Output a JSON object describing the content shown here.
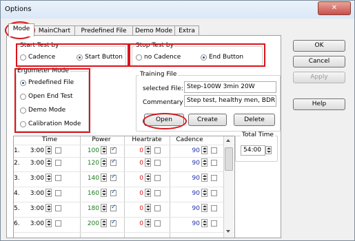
{
  "window": {
    "title": "Options",
    "close_glyph": "✕"
  },
  "tabs": [
    {
      "label": "Mode",
      "selected": true
    },
    {
      "label": "MainChart",
      "selected": false
    },
    {
      "label": "Predefined File",
      "selected": false
    },
    {
      "label": "Demo Mode",
      "selected": false
    },
    {
      "label": "Extra",
      "selected": false
    }
  ],
  "start_test": {
    "title": "Start Test by",
    "options": [
      {
        "label": "Cadence",
        "selected": false
      },
      {
        "label": "Start Button",
        "selected": true
      }
    ]
  },
  "stop_test": {
    "title": "Stop Test by",
    "options": [
      {
        "label": "no Cadence",
        "selected": false
      },
      {
        "label": "End Button",
        "selected": true
      }
    ]
  },
  "ergometer_mode": {
    "title": "Ergometer Mode",
    "options": [
      {
        "label": "Predefined File",
        "selected": true
      },
      {
        "label": "Open End Test",
        "selected": false
      },
      {
        "label": "Demo Mode",
        "selected": false
      },
      {
        "label": "Calibration Mode",
        "selected": false
      }
    ]
  },
  "training_file": {
    "title": "Training File",
    "selected_file_label": "selected File:",
    "selected_file_value": "Step-100W 3min 20W",
    "commentary_label": "Commentary",
    "commentary_value": "Step test, healthy men, BDR p",
    "open_button": "Open",
    "create_button": "Create",
    "delete_button": "Delete"
  },
  "side_buttons": {
    "ok": "OK",
    "cancel": "Cancel",
    "apply": "Apply",
    "help": "Help"
  },
  "grid": {
    "headers": {
      "time": "Time",
      "power": "Power",
      "heartrate": "Heartrate",
      "cadence": "Cadence"
    },
    "rows": [
      {
        "num": "1.",
        "time": "3:00",
        "power": "100",
        "power_checked": true,
        "heartrate": "0",
        "cadence": "90"
      },
      {
        "num": "2.",
        "time": "3:00",
        "power": "120",
        "power_checked": true,
        "heartrate": "0",
        "cadence": "90"
      },
      {
        "num": "3.",
        "time": "3:00",
        "power": "140",
        "power_checked": true,
        "heartrate": "0",
        "cadence": "90"
      },
      {
        "num": "4.",
        "time": "3:00",
        "power": "160",
        "power_checked": true,
        "heartrate": "0",
        "cadence": "90"
      },
      {
        "num": "5.",
        "time": "3:00",
        "power": "180",
        "power_checked": true,
        "heartrate": "0",
        "cadence": "90"
      },
      {
        "num": "6.",
        "time": "3:00",
        "power": "200",
        "power_checked": true,
        "heartrate": "0",
        "cadence": "90"
      }
    ]
  },
  "total_time": {
    "label": "Total Time",
    "value": "54:00"
  },
  "colors": {
    "highlight": "#d9141b",
    "power_value": "#1a7a1a",
    "heartrate_value": "#d9141b",
    "cadence_value": "#1f2fb0"
  },
  "icons": {
    "close": "close-icon",
    "spin": "spin-icon",
    "radio": "radio-icon",
    "checkbox": "checkbox-icon"
  }
}
